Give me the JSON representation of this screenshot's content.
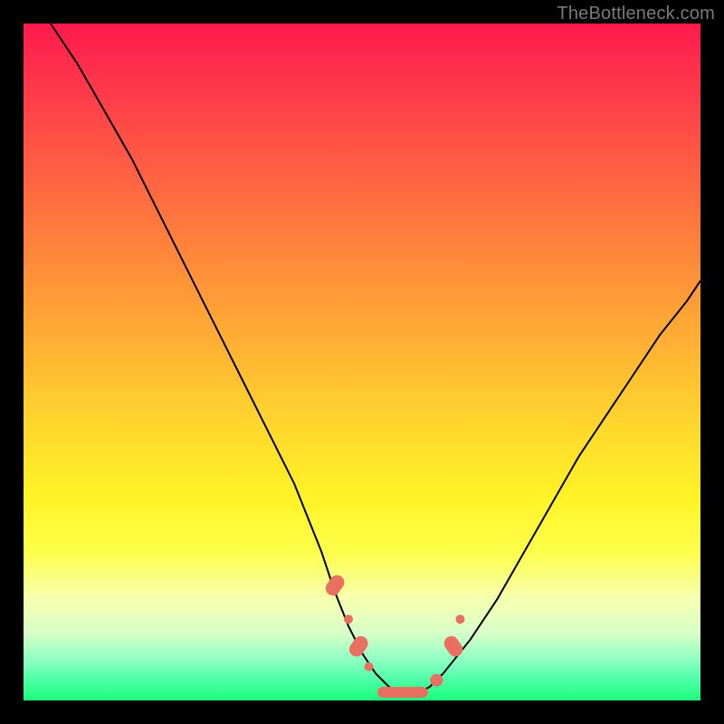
{
  "watermark": "TheBottleneck.com",
  "colors": {
    "frame": "#000000",
    "curve": "#000000",
    "marker": "#e97060",
    "gradient_stops": [
      "#ff1a4d",
      "#ff3a4a",
      "#ff5a44",
      "#ff7a3e",
      "#ff9a38",
      "#ffb932",
      "#ffd92c",
      "#fff326",
      "#fdff4a",
      "#f6ffb0",
      "#d8ffc8",
      "#8effc2",
      "#4cffa6",
      "#1aff7a"
    ]
  },
  "chart_data": {
    "type": "line",
    "title": "",
    "xlabel": "",
    "ylabel": "",
    "xlim": [
      0,
      100
    ],
    "ylim": [
      0,
      100
    ],
    "grid": false,
    "legend": false,
    "series": [
      {
        "name": "bottleneck-curve",
        "x": [
          4,
          8,
          12,
          16,
          20,
          24,
          28,
          32,
          36,
          40,
          44,
          46,
          48,
          50,
          52,
          54,
          56,
          58,
          60,
          62,
          66,
          70,
          74,
          78,
          82,
          86,
          90,
          94,
          98,
          100
        ],
        "y": [
          100,
          94,
          87,
          80,
          72,
          64,
          56,
          48,
          40,
          32,
          22,
          16,
          11,
          7,
          4,
          2,
          1,
          1,
          2,
          4,
          9,
          15,
          22,
          29,
          36,
          42,
          48,
          54,
          59,
          62
        ]
      }
    ],
    "markers": [
      {
        "x": 46,
        "y": 17,
        "shape": "pill"
      },
      {
        "x": 48,
        "y": 12,
        "shape": "dot-small"
      },
      {
        "x": 49.5,
        "y": 8,
        "shape": "pill"
      },
      {
        "x": 51,
        "y": 5,
        "shape": "dot-small"
      },
      {
        "x": 56,
        "y": 1.2,
        "shape": "bar"
      },
      {
        "x": 61,
        "y": 3,
        "shape": "dot"
      },
      {
        "x": 63.5,
        "y": 8,
        "shape": "pill"
      },
      {
        "x": 64.5,
        "y": 12,
        "shape": "dot-small"
      }
    ]
  }
}
